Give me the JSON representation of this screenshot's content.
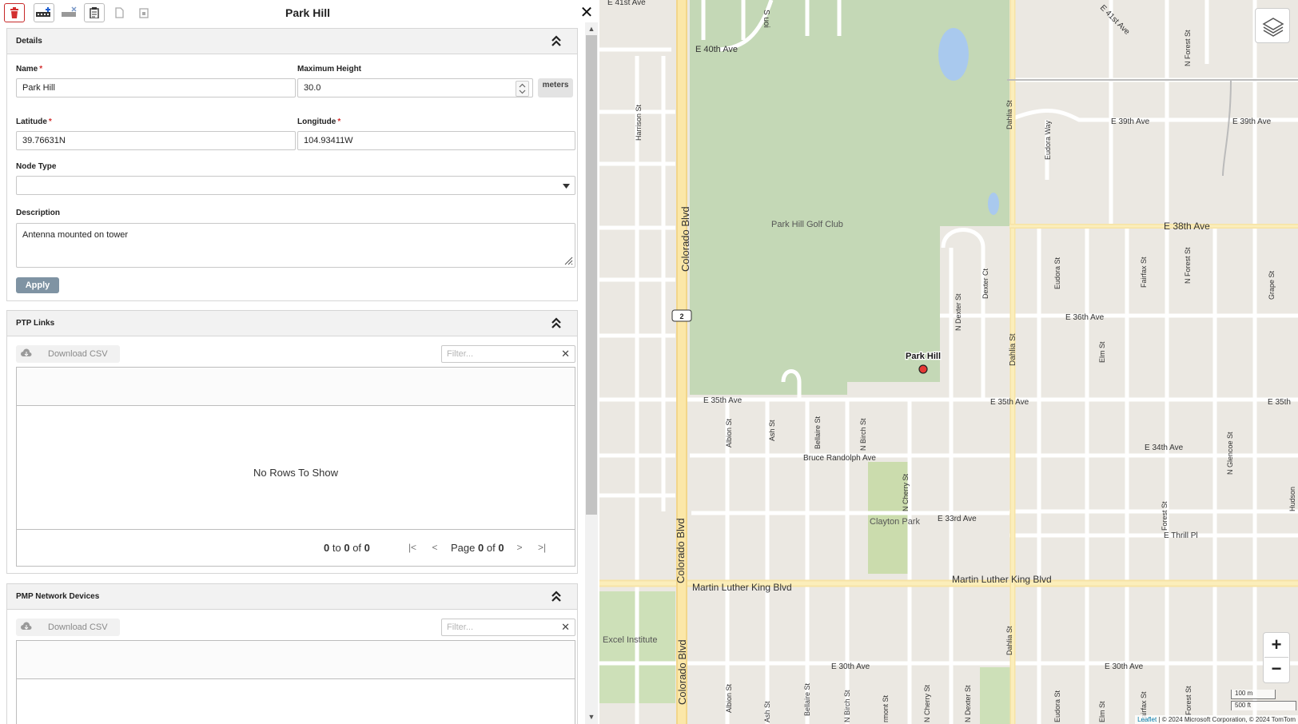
{
  "panel": {
    "title": "Park Hill",
    "details": {
      "section_title": "Details",
      "name_label": "Name",
      "name_value": "Park Hill",
      "max_height_label": "Maximum Height",
      "max_height_value": "30.0",
      "unit_label": "meters",
      "latitude_label": "Latitude",
      "latitude_value": "39.76631N",
      "longitude_label": "Longitude",
      "longitude_value": "104.93411W",
      "node_type_label": "Node Type",
      "node_type_value": "",
      "description_label": "Description",
      "description_value": "Antenna mounted on tower",
      "apply_label": "Apply",
      "required_mark": "*"
    },
    "ptp": {
      "section_title": "PTP Links",
      "download_label": "Download CSV",
      "filter_placeholder": "Filter...",
      "no_rows": "No Rows To Show",
      "pager": {
        "from": "0",
        "to_word": "to",
        "to": "0",
        "of_word": "of",
        "total": "0",
        "page_word": "Page",
        "page": "0",
        "pages": "0"
      }
    },
    "pmp": {
      "section_title": "PMP Network Devices",
      "download_label": "Download CSV",
      "filter_placeholder": "Filter..."
    }
  },
  "map": {
    "marker_label": "Park Hill",
    "zoom_in": "+",
    "zoom_out": "−",
    "scale_metric": "100 m",
    "scale_imperial": "500 ft",
    "attribution_leaflet": "Leaflet",
    "attribution_rest": " | © 2024 Microsoft Corporation, © 2024 TomTom",
    "route_shield": "2",
    "labels": {
      "colorado_blvd": "Colorado Blvd",
      "golf_club": "Park Hill Golf Club",
      "clayton_park": "Clayton Park",
      "excel_institute": "Excel Institute",
      "e41st": "E 41st Ave",
      "e41st_diag": "E 41st Ave",
      "e40th": "E 40th Ave",
      "e39th_a": "E 39th Ave",
      "e39th_b": "E 39th Ave",
      "e38th": "E 38th Ave",
      "e36th": "E 36th Ave",
      "e35th_a": "E 35th Ave",
      "e35th_b": "E 35th Ave",
      "e35th_c": "E 35th",
      "e34th": "E 34th Ave",
      "bruce_randolph": "Bruce Randolph Ave",
      "e33rd": "E 33rd Ave",
      "e_thrill": "E Thrill Pl",
      "mlk": "Martin Luther King Blvd",
      "e30th_a": "E 30th Ave",
      "e30th_b": "E 30th Ave",
      "harrison": "Harrison St",
      "dahlia": "Dahlia St",
      "eudora": "Eudora Way",
      "n_forest": "N Forest St",
      "eudora_st": "Eudora St",
      "fairfax": "Fairfax St",
      "grape": "Grape St",
      "n_dexter": "N Dexter St",
      "dexter_ct": "Dexter Ct",
      "elm": "Elm St",
      "n_glencoe": "N Glencoe St",
      "forest": "Forest St",
      "albion": "Albion St",
      "ash": "Ash St",
      "bellaire": "Bellaire St",
      "n_birch": "N Birch St",
      "n_cherry": "N Cherry St",
      "monaco_partial": "S uoi",
      "n_dexter_s": "N Dexter St",
      "fairmont_partial": "rmont St",
      "hudson_partial": "Hudson"
    }
  }
}
